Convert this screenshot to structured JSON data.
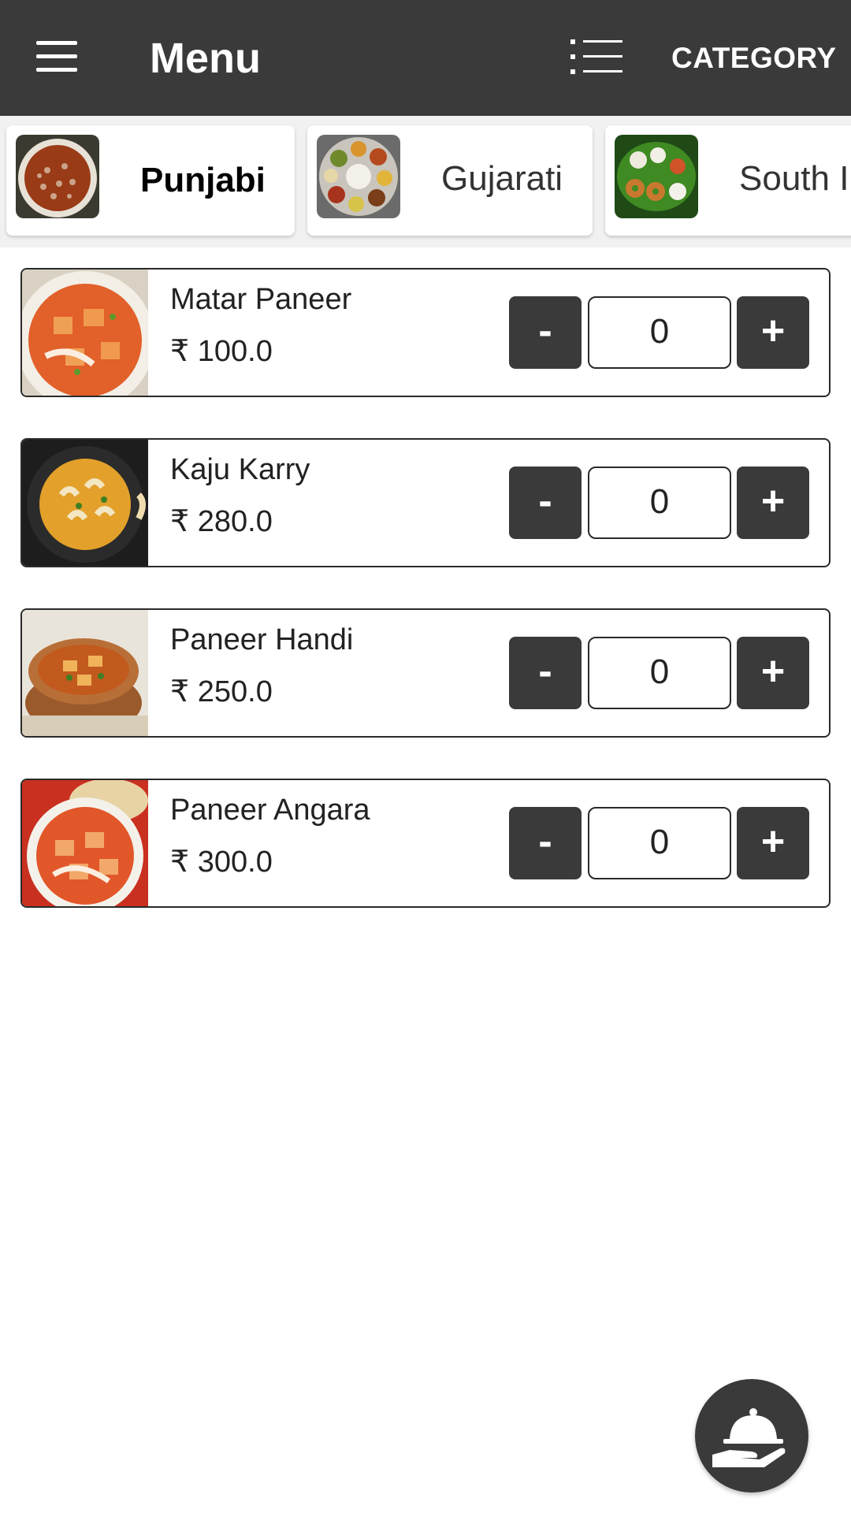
{
  "appbar": {
    "title": "Menu",
    "menu_icon": "hamburger-menu-icon",
    "list_icon": "list-view-icon",
    "category_label": "CATEGORY"
  },
  "categories": [
    {
      "label": "Punjabi",
      "active": true,
      "thumb": "punjabi-dish-image"
    },
    {
      "label": "Gujarati",
      "active": false,
      "thumb": "gujarati-thali-image"
    },
    {
      "label": "South Indian",
      "active": false,
      "thumb": "south-indian-platter-image"
    }
  ],
  "items": [
    {
      "name": "Matar Paneer",
      "price": "₹ 100.0",
      "qty": "0",
      "minus": "-",
      "plus": "+"
    },
    {
      "name": "Kaju Karry",
      "price": "₹ 280.0",
      "qty": "0",
      "minus": "-",
      "plus": "+"
    },
    {
      "name": "Paneer Handi",
      "price": "₹ 250.0",
      "qty": "0",
      "minus": "-",
      "plus": "+"
    },
    {
      "name": "Paneer Angara",
      "price": "₹ 300.0",
      "qty": "0",
      "minus": "-",
      "plus": "+"
    }
  ],
  "fab": {
    "icon": "serving-cloche-hand-icon"
  },
  "colors": {
    "appbar_bg": "#3a3a3a",
    "button_bg": "#3a3a3a",
    "strip_bg": "#f1f1f1",
    "text": "#222222"
  }
}
